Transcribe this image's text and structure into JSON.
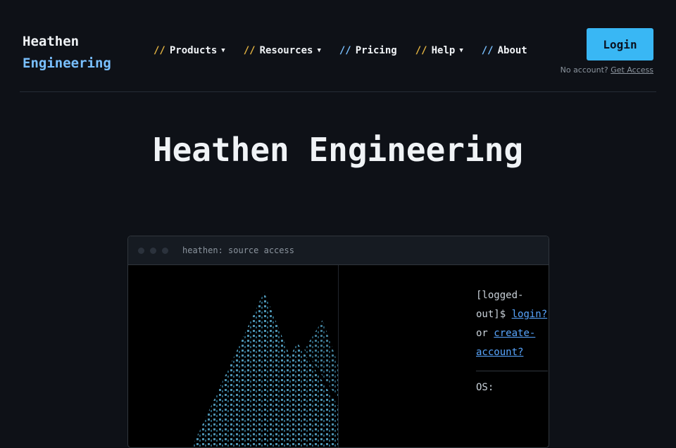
{
  "brand": {
    "line1": "Heathen",
    "line2": "Engineering"
  },
  "nav": {
    "items": [
      {
        "slashes": "//",
        "label": "Products",
        "caret": "▼",
        "slash_color": "#e3b341"
      },
      {
        "slashes": "//",
        "label": "Resources",
        "caret": "▼",
        "slash_color": "#e3b341"
      },
      {
        "slashes": "//",
        "label": "Pricing",
        "caret": "",
        "slash_color": "#79c0ff"
      },
      {
        "slashes": "//",
        "label": "Help",
        "caret": "▼",
        "slash_color": "#e3b341"
      },
      {
        "slashes": "//",
        "label": "About",
        "caret": "",
        "slash_color": "#79c0ff"
      }
    ]
  },
  "auth": {
    "login_label": "Login",
    "no_account_text": "No account?",
    "get_access_label": "Get Access"
  },
  "hero": {
    "title": "Heathen Engineering"
  },
  "terminal": {
    "title": "heathen: source access",
    "prompt_open": "[logged-out]$",
    "login_link": "login?",
    "or_text": "or",
    "create_link": "create-account?",
    "os_label": "OS:"
  },
  "colors": {
    "accent": "#39b7f4",
    "background": "#0e1117",
    "link": "#58a6ff"
  }
}
